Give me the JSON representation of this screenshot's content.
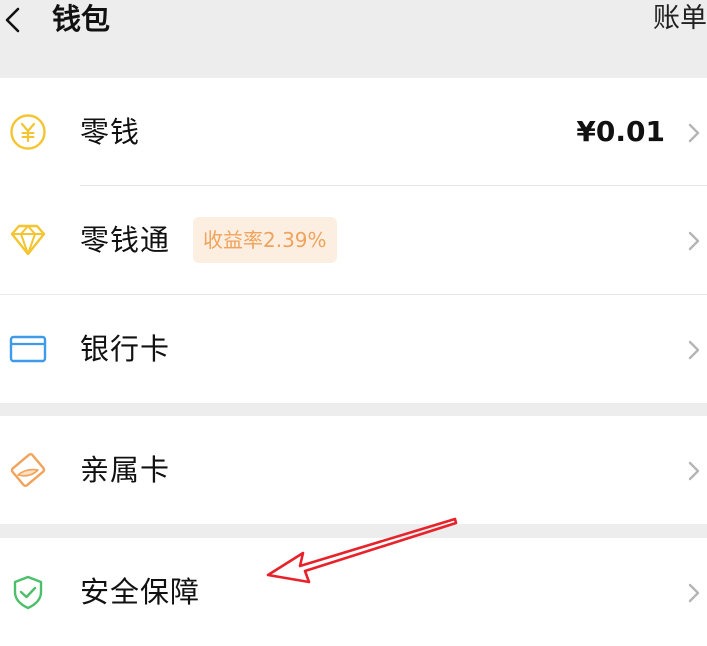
{
  "header": {
    "back_icon": "chevron-left-icon",
    "title": "钱包",
    "bill_label": "账单"
  },
  "items": [
    {
      "icon": "yuan-coin-icon",
      "label": "零钱",
      "value": "¥0.01"
    },
    {
      "icon": "diamond-icon",
      "label": "零钱通",
      "badge": "收益率2.39%"
    },
    {
      "icon": "bank-card-icon",
      "label": "银行卡"
    },
    {
      "icon": "family-card-icon",
      "label": "亲属卡"
    },
    {
      "icon": "shield-check-icon",
      "label": "安全保障"
    }
  ],
  "annotation": {
    "icon": "red-arrow-icon"
  },
  "colors": {
    "background": "#ededed",
    "surface": "#ffffff",
    "coin": "#f4c531",
    "diamond": "#f4c531",
    "bank_card": "#3d9be9",
    "family_card": "#f2a35b",
    "shield": "#4cbf6b",
    "badge_bg": "#fdeee2",
    "badge_text": "#f0a35a",
    "annotation_arrow": "#e8222a"
  }
}
